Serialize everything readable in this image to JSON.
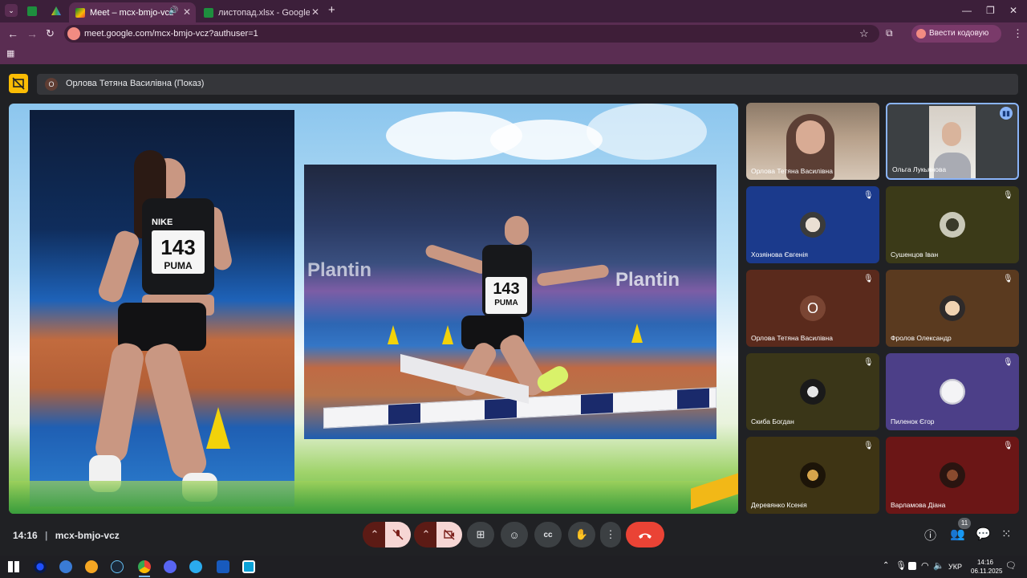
{
  "browser": {
    "tabs": [
      {
        "title": "Meet – mcx-bmjo-vcz",
        "active": true
      },
      {
        "title": "листопад.xlsx - Google Таблиц",
        "active": false
      }
    ],
    "url": "meet.google.com/mcx-bmjo-vcz?authuser=1",
    "passkey_label": "Ввести кодовую фразу"
  },
  "meet": {
    "presenter_initial": "О",
    "presenter_label": "Орлова Тетяна Василівна (Показ)",
    "slide": {
      "bib_number": "143",
      "bib_brand": "PUMA",
      "shirt_brand": "NIKE",
      "banner_text": "Plantin"
    },
    "participants": [
      {
        "name": "Орлова Тетяна Василівна",
        "video": true,
        "muted": false
      },
      {
        "name": "Ольга Лукьянова",
        "video": true,
        "muted": false,
        "speaking": true
      },
      {
        "name": "Хозяінова Євгенія",
        "video": false,
        "muted": true,
        "bg": "#1b3a8c"
      },
      {
        "name": "Сушенцов Іван",
        "video": false,
        "muted": true,
        "bg": "#3b3a18"
      },
      {
        "name": "Орлова Тетяна Василівна",
        "video": false,
        "muted": true,
        "bg": "#5a2a1c",
        "initial": "О"
      },
      {
        "name": "Фролов Олександр",
        "video": false,
        "muted": true,
        "bg": "#5a3a1f"
      },
      {
        "name": "Скиба Богдан",
        "video": false,
        "muted": true,
        "bg": "#3a3618"
      },
      {
        "name": "Пиленок Єгор",
        "video": false,
        "muted": true,
        "bg": "#4c3f88"
      },
      {
        "name": "Деревянко Ксенія",
        "video": false,
        "muted": true,
        "bg": "#3e3414"
      },
      {
        "name": "Варламова Діана",
        "video": false,
        "muted": true,
        "bg": "#6b1616"
      }
    ],
    "time": "14:16",
    "meeting_code": "mcx-bmjo-vcz",
    "people_count": "11"
  },
  "taskbar": {
    "lang": "УКР",
    "time": "14:16",
    "date": "06.11.2025"
  },
  "colors": {
    "chrome_tabbar": "#3c1f3a",
    "chrome_toolbar": "#5a2d52",
    "meet_bg": "#202124",
    "end_call": "#ea4335",
    "present_icon": "#fbbc04"
  }
}
